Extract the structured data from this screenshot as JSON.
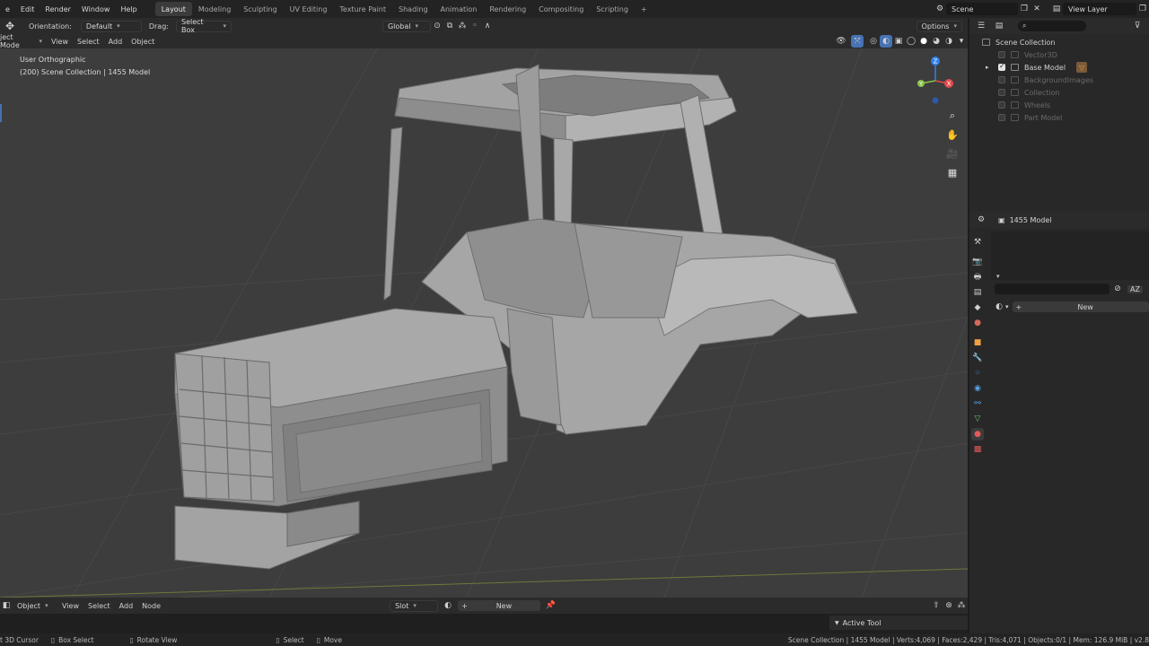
{
  "topbar": {
    "menus": [
      "e",
      "Edit",
      "Render",
      "Window",
      "Help"
    ],
    "workspaces": [
      "Layout",
      "Modeling",
      "Sculpting",
      "UV Editing",
      "Texture Paint",
      "Shading",
      "Animation",
      "Rendering",
      "Compositing",
      "Scripting"
    ],
    "active_workspace": "Layout",
    "add_tab": "+",
    "scene": "Scene",
    "view_layer": "View Layer"
  },
  "toolbar": {
    "orientation_label": "Orientation:",
    "orientation_value": "Default",
    "drag_label": "Drag:",
    "drag_value": "Select Box",
    "transform_orientation": "Global",
    "options": "Options"
  },
  "header": {
    "mode": "ject Mode",
    "items": [
      "View",
      "Select",
      "Add",
      "Object"
    ]
  },
  "viewport": {
    "view_name": "User Orthographic",
    "collection_info": "(200) Scene Collection | 1455 Model",
    "gizmo_axes": {
      "x": "X",
      "y": "Y",
      "z": "Z"
    }
  },
  "outliner": {
    "root": "Scene Collection",
    "items": [
      {
        "name": "Vector3D",
        "enabled": false
      },
      {
        "name": "Base Model",
        "enabled": true
      },
      {
        "name": "BackgroundImages",
        "enabled": false
      },
      {
        "name": "Collection",
        "enabled": false
      },
      {
        "name": "Wheels",
        "enabled": false
      },
      {
        "name": "Part Model",
        "enabled": false
      }
    ]
  },
  "properties": {
    "object_name": "1455 Model",
    "new_button": "New",
    "sort_label": "AZ"
  },
  "node_editor": {
    "mode": "Object",
    "items": [
      "View",
      "Select",
      "Add",
      "Node"
    ],
    "slot": "Slot",
    "new_button": "New",
    "active_tool": "Active Tool"
  },
  "status": {
    "left": [
      {
        "key": "cursor",
        "label": "t 3D Cursor"
      },
      {
        "key": "box",
        "label": "Box Select"
      },
      {
        "key": "rotate",
        "label": "Rotate View"
      },
      {
        "key": "select",
        "label": "Select"
      },
      {
        "key": "move",
        "label": "Move"
      }
    ],
    "stats": "Scene Collection | 1455 Model | Verts:4,069 | Faces:2,429 | Tris:4,071 | Objects:0/1 | Mem: 126.9 MiB | v2.8"
  },
  "colors": {
    "accent": "#4772b3",
    "axis_x": "#e14b4b",
    "axis_y": "#8bc34a",
    "axis_z": "#2f80ed",
    "model": "#9a9a9a"
  }
}
